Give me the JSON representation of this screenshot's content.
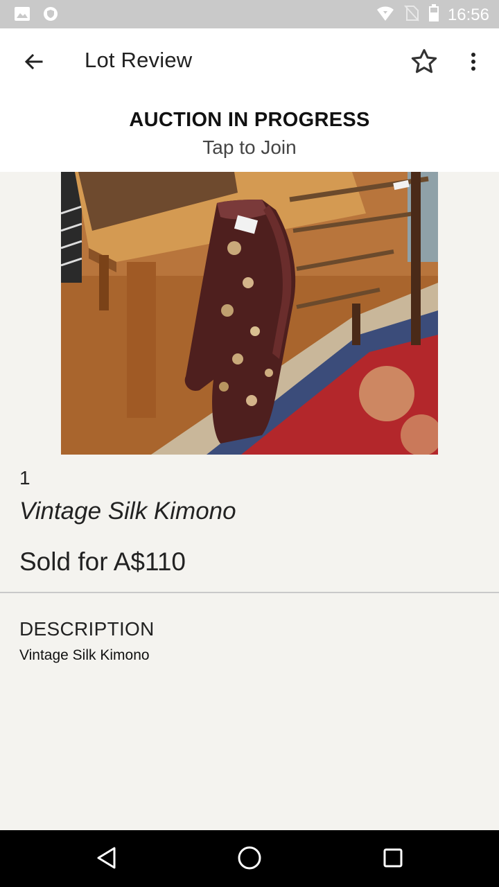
{
  "status_bar": {
    "time": "16:56",
    "icons": [
      "image-icon",
      "shield-icon",
      "wifi-icon",
      "no-sim-icon",
      "battery-icon"
    ]
  },
  "app_bar": {
    "title": "Lot Review",
    "icons": [
      "back-arrow-icon",
      "star-outline-icon",
      "more-vert-icon"
    ]
  },
  "banner": {
    "headline": "AUCTION IN PROGRESS",
    "action": "Tap to Join"
  },
  "lot": {
    "number": "1",
    "name": "Vintage Silk Kimono",
    "result": "Sold for A$110"
  },
  "description": {
    "heading": "DESCRIPTION",
    "body": "Vintage Silk Kimono"
  },
  "nav_bar": {
    "icons": [
      "back-triangle-icon",
      "home-circle-icon",
      "recents-square-icon"
    ]
  },
  "colors": {
    "status_bar": "#c9c9c9",
    "page_background": "#f4f3ef",
    "app_bar": "#ffffff",
    "nav_bar": "#000000"
  }
}
